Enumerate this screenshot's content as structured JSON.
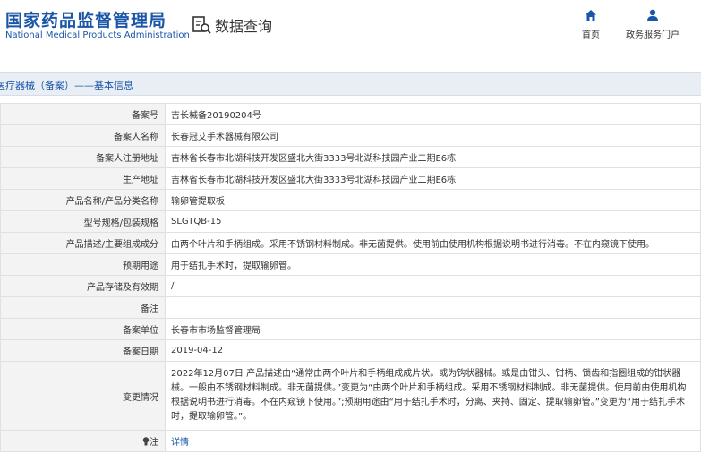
{
  "header": {
    "logo_cn": "国家药品监督管理局",
    "logo_en": "National Medical Products Administration",
    "query_title": "数据查询",
    "nav": [
      {
        "label": "首页",
        "icon": "home-icon"
      },
      {
        "label": "政务服务门户",
        "icon": "user-icon"
      }
    ]
  },
  "section_title": "医疗器械（备案）——基本信息",
  "rows": [
    {
      "label": "备案号",
      "value": "吉长械备20190204号"
    },
    {
      "label": "备案人名称",
      "value": "长春冠艾手术器械有限公司"
    },
    {
      "label": "备案人注册地址",
      "value": "吉林省长春市北湖科技开发区盛北大街3333号北湖科技园产业二期E6栋"
    },
    {
      "label": "生产地址",
      "value": "吉林省长春市北湖科技开发区盛北大街3333号北湖科技园产业二期E6栋"
    },
    {
      "label": "产品名称/产品分类名称",
      "value": "输卵管提取板"
    },
    {
      "label": "型号规格/包装规格",
      "value": "SLGTQB-15"
    },
    {
      "label": "产品描述/主要组成成分",
      "value": "由两个叶片和手柄组成。采用不锈钢材料制成。非无菌提供。使用前由使用机构根据说明书进行消毒。不在内窥镜下使用。"
    },
    {
      "label": "预期用途",
      "value": "用于结扎手术时，提取输卵管。"
    },
    {
      "label": "产品存储及有效期",
      "value": "/"
    },
    {
      "label": "备注",
      "value": ""
    },
    {
      "label": "备案单位",
      "value": "长春市市场监督管理局"
    },
    {
      "label": "备案日期",
      "value": "2019-04-12"
    },
    {
      "label": "变更情况",
      "value": "2022年12月07日 产品描述由“通常由两个叶片和手柄组成成片状。或为钩状器械。或是由钳头、钳柄、锁齿和指圈组成的钳状器械。一般由不锈钢材料制成。非无菌提供。”变更为“由两个叶片和手柄组成。采用不锈钢材料制成。非无菌提供。使用前由使用机构根据说明书进行消毒。不在内窥镜下使用。”;预期用途由“用于结扎手术时，分离、夹持、固定、提取输卵管。”变更为“用于结扎手术时，提取输卵管。”。"
    },
    {
      "label": "注",
      "value": "详情"
    }
  ]
}
